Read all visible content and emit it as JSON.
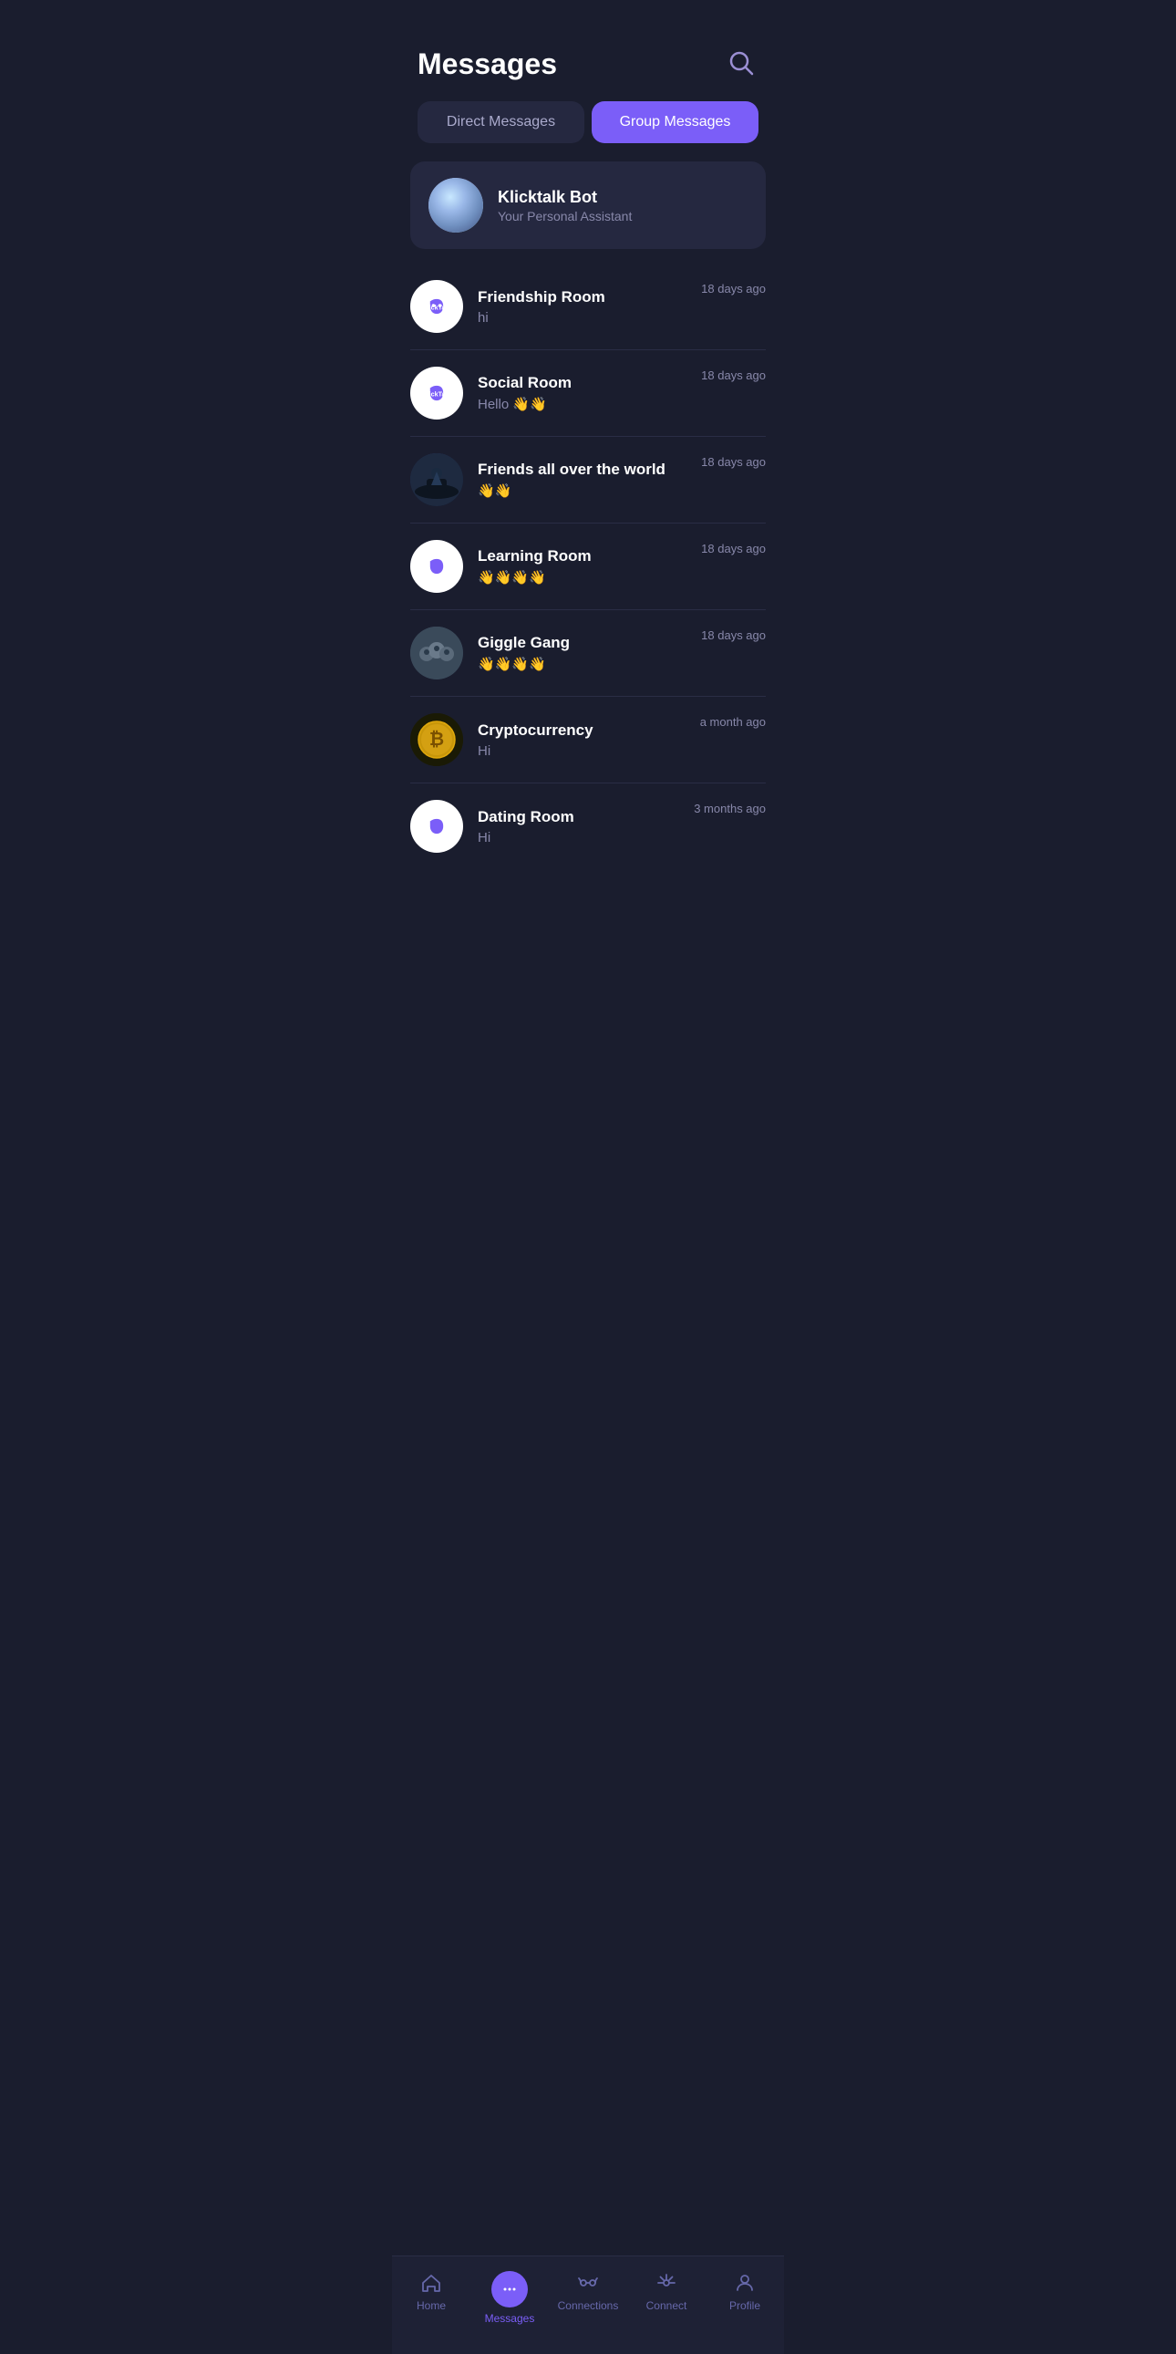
{
  "header": {
    "title": "Messages",
    "search_label": "Search"
  },
  "tabs": [
    {
      "id": "direct",
      "label": "Direct Messages",
      "active": false
    },
    {
      "id": "group",
      "label": "Group Messages",
      "active": true
    }
  ],
  "bot": {
    "name": "Klicktalk Bot",
    "subtitle": "Your Personal Assistant"
  },
  "groups": [
    {
      "id": 1,
      "name": "Friendship Room",
      "preview": "hi",
      "time": "18 days ago",
      "avatar_type": "klicktalk"
    },
    {
      "id": 2,
      "name": "Social Room",
      "preview": "Hello 👋👋",
      "time": "18 days ago",
      "avatar_type": "klicktalk"
    },
    {
      "id": 3,
      "name": "Friends all over the world",
      "preview": "👋👋",
      "time": "18 days ago",
      "avatar_type": "friends"
    },
    {
      "id": 4,
      "name": "Learning Room",
      "preview": "👋👋👋👋",
      "time": "18 days ago",
      "avatar_type": "klicktalk"
    },
    {
      "id": 5,
      "name": "Giggle Gang",
      "preview": "👋👋👋👋",
      "time": "18 days ago",
      "avatar_type": "giggle"
    },
    {
      "id": 6,
      "name": "Cryptocurrency",
      "preview": "Hi",
      "time": "a month ago",
      "avatar_type": "crypto"
    },
    {
      "id": 7,
      "name": "Dating Room",
      "preview": "Hi",
      "time": "3 months ago",
      "avatar_type": "klicktalk"
    }
  ],
  "nav": {
    "items": [
      {
        "id": "home",
        "label": "Home",
        "active": false
      },
      {
        "id": "messages",
        "label": "Messages",
        "active": true
      },
      {
        "id": "connections",
        "label": "Connections",
        "active": false
      },
      {
        "id": "connect",
        "label": "Connect",
        "active": false
      },
      {
        "id": "profile",
        "label": "Profile",
        "active": false
      }
    ]
  }
}
